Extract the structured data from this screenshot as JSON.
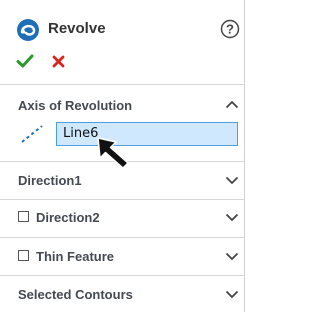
{
  "feature": {
    "title": "Revolve",
    "icon": "revolve-feature-icon",
    "help_icon": "help-question-icon",
    "ok_icon": "green-checkmark-icon",
    "cancel_icon": "red-x-icon"
  },
  "sections": {
    "axis_of_revolution": {
      "title": "Axis of Revolution",
      "expanded": true,
      "axis_icon": "axis-line-icon",
      "field_value": "Line6"
    },
    "direction1": {
      "title": "Direction1",
      "expanded": false
    },
    "direction2": {
      "title": "Direction2",
      "checked": false,
      "expanded": false
    },
    "thin_feature": {
      "title": "Thin Feature",
      "checked": false,
      "expanded": false
    },
    "selected_contours": {
      "title": "Selected Contours",
      "expanded": false
    }
  },
  "colors": {
    "accent_blue": "#1f6fb8",
    "ok_green": "#2a9a2a",
    "cancel_red": "#d7261e",
    "field_bg": "#cfe8fd",
    "field_border": "#4f9ee0"
  }
}
